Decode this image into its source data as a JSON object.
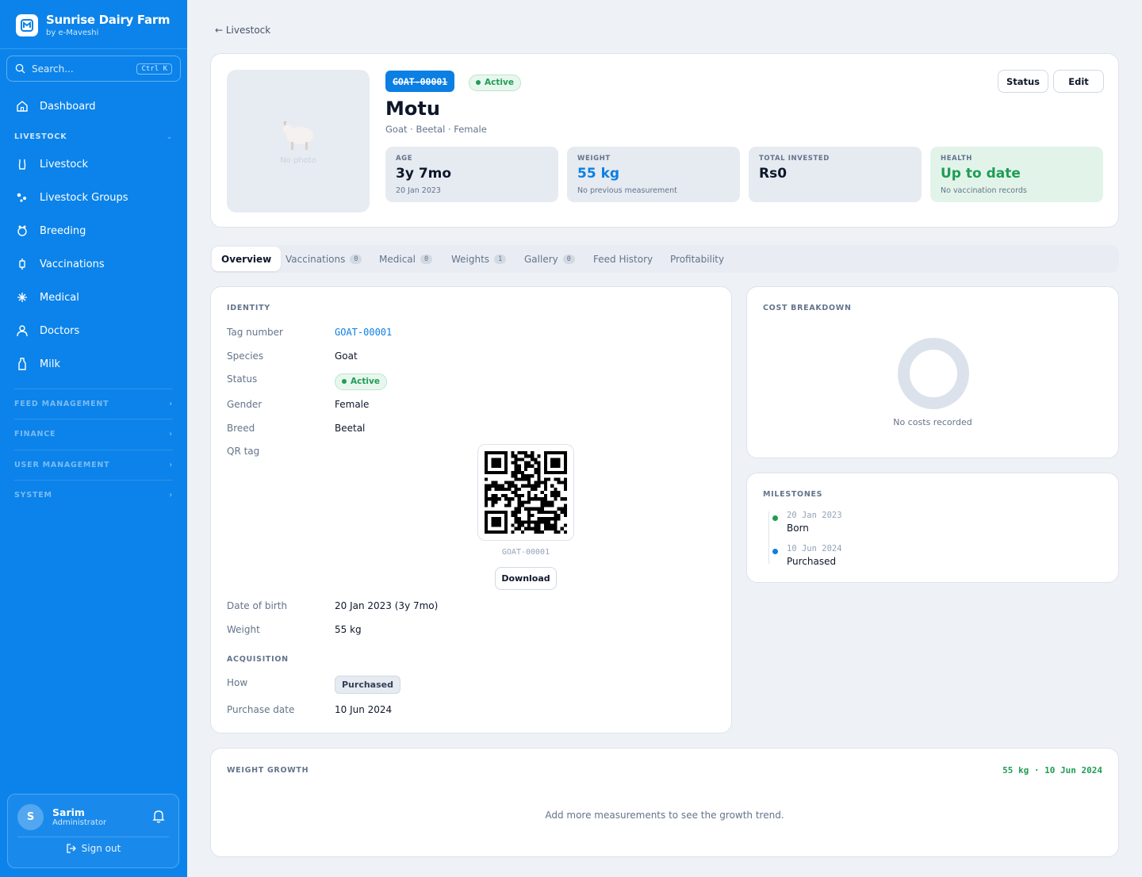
{
  "sidebar": {
    "brand": {
      "name": "Sunrise Dairy Farm",
      "subtitle": "by e-Maveshi"
    },
    "search": {
      "placeholder": "Search...",
      "shortcut": "Ctrl K"
    },
    "dashboard": "Dashboard",
    "livestock_section": "LIVESTOCK",
    "items": [
      "Livestock",
      "Livestock Groups",
      "Breeding",
      "Vaccinations",
      "Medical",
      "Doctors",
      "Milk"
    ],
    "sections": [
      "FEED MANAGEMENT",
      "FINANCE",
      "USER MANAGEMENT",
      "SYSTEM"
    ],
    "user": {
      "initial": "S",
      "name": "Sarim",
      "role": "Administrator",
      "signout": "Sign out"
    }
  },
  "breadcrumb": "← Livestock",
  "animal": {
    "tag": "GOAT-00001",
    "status": "Active",
    "name": "Motu",
    "subline": "Goat · Beetal · Female",
    "no_photo": "No photo",
    "actions": {
      "status": "Status",
      "edit": "Edit"
    }
  },
  "stats": [
    {
      "label": "AGE",
      "value": "3y 7mo",
      "sub": "20 Jan 2023",
      "color": "#0f172a"
    },
    {
      "label": "WEIGHT",
      "value": "55 kg",
      "sub": "No previous measurement",
      "color": "#0b7fe3"
    },
    {
      "label": "TOTAL INVESTED",
      "value": "Rs0",
      "sub": "",
      "color": "#0f172a"
    },
    {
      "label": "HEALTH",
      "value": "Up to date",
      "sub": "No vaccination records",
      "color": "#1f9d55"
    }
  ],
  "tabs": [
    {
      "label": "Overview"
    },
    {
      "label": "Vaccinations",
      "count": "0"
    },
    {
      "label": "Medical",
      "count": "0"
    },
    {
      "label": "Weights",
      "count": "1"
    },
    {
      "label": "Gallery",
      "count": "0"
    },
    {
      "label": "Feed History"
    },
    {
      "label": "Profitability"
    }
  ],
  "identity": {
    "title": "IDENTITY",
    "tag_label": "Tag number",
    "tag_value": "GOAT-00001",
    "species_label": "Species",
    "species_value": "Goat",
    "status_label": "Status",
    "status_value": "Active",
    "gender_label": "Gender",
    "gender_value": "Female",
    "breed_label": "Breed",
    "breed_value": "Beetal",
    "qr_label": "QR tag",
    "qr_caption": "GOAT-00001",
    "download": "Download",
    "dob_label": "Date of birth",
    "dob_value": "20 Jan 2023 (3y 7mo)",
    "weight_label": "Weight",
    "weight_value": "55 kg"
  },
  "acquisition": {
    "title": "ACQUISITION",
    "how_label": "How",
    "how_value": "Purchased",
    "date_label": "Purchase date",
    "date_value": "10 Jun 2024"
  },
  "cost": {
    "title": "COST BREAKDOWN",
    "empty": "No costs recorded"
  },
  "milestones": {
    "title": "MILESTONES",
    "items": [
      {
        "date": "20 Jan 2023",
        "label": "Born",
        "color": "#1f9d55"
      },
      {
        "date": "10 Jun 2024",
        "label": "Purchased",
        "color": "#0b7fe3"
      }
    ]
  },
  "weight_growth": {
    "title": "WEIGHT GROWTH",
    "latest": "55 kg · 10 Jun 2024",
    "empty": "Add more measurements to see the growth trend."
  }
}
